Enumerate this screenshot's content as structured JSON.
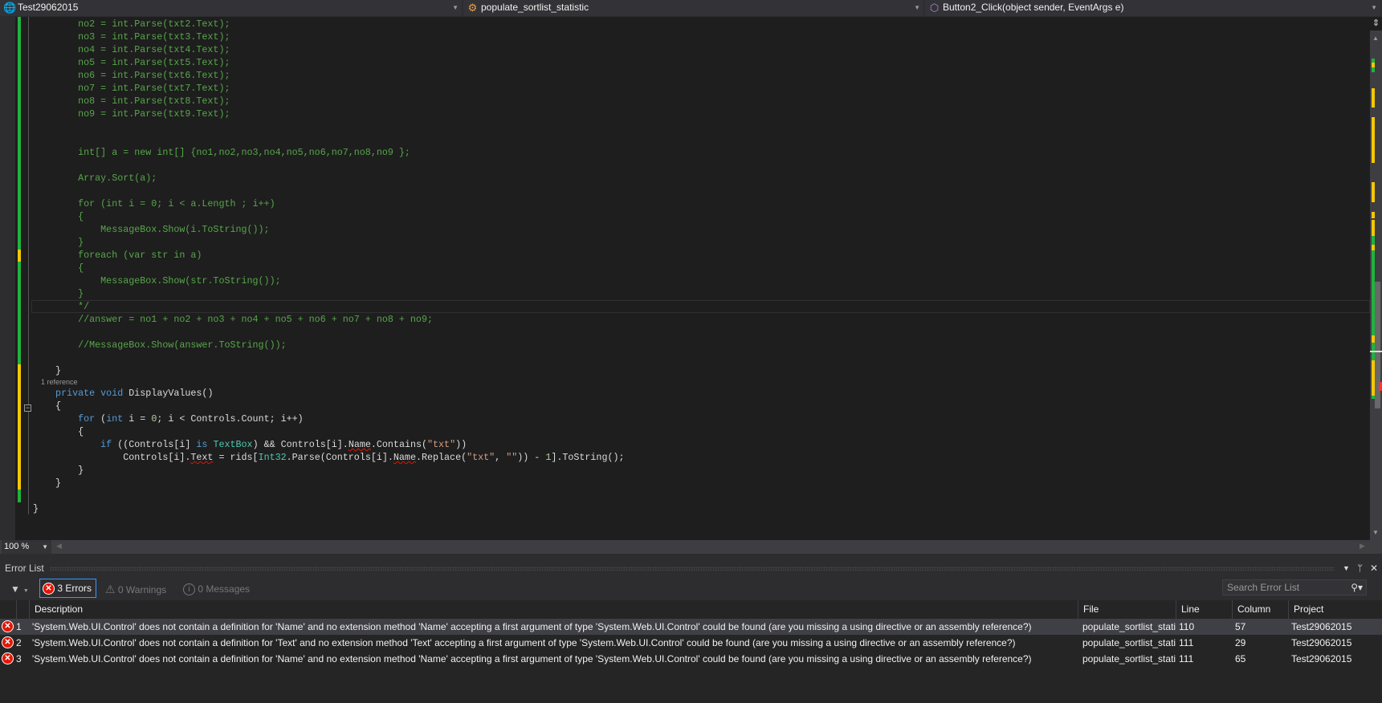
{
  "navbar": {
    "project": "Test29062015",
    "class": "populate_sortlist_statistic",
    "member": "Button2_Click(object sender, EventArgs e)"
  },
  "editor": {
    "lines": [
      [
        [
          "c",
          "        no2 = int.Parse(txt2.Text);"
        ]
      ],
      [
        [
          "c",
          "        no3 = int.Parse(txt3.Text);"
        ]
      ],
      [
        [
          "c",
          "        no4 = int.Parse(txt4.Text);"
        ]
      ],
      [
        [
          "c",
          "        no5 = int.Parse(txt5.Text);"
        ]
      ],
      [
        [
          "c",
          "        no6 = int.Parse(txt6.Text);"
        ]
      ],
      [
        [
          "c",
          "        no7 = int.Parse(txt7.Text);"
        ]
      ],
      [
        [
          "c",
          "        no8 = int.Parse(txt8.Text);"
        ]
      ],
      [
        [
          "c",
          "        no9 = int.Parse(txt9.Text);"
        ]
      ],
      [],
      [],
      [
        [
          "c",
          "        int[] a = new int[] {no1,no2,no3,no4,no5,no6,no7,no8,no9 };"
        ]
      ],
      [],
      [
        [
          "c",
          "        Array.Sort(a);"
        ]
      ],
      [],
      [
        [
          "c",
          "        for (int i = 0; i < a.Length ; i++)"
        ]
      ],
      [
        [
          "c",
          "        {"
        ]
      ],
      [
        [
          "c",
          "            MessageBox.Show(i.ToString());"
        ]
      ],
      [
        [
          "c",
          "        }"
        ]
      ],
      [
        [
          "c",
          "        foreach (var str in a)"
        ]
      ],
      [
        [
          "c",
          "        {"
        ]
      ],
      [
        [
          "c",
          "            MessageBox.Show(str.ToString());"
        ]
      ],
      [
        [
          "c",
          "        }"
        ]
      ],
      [
        [
          "c",
          "        */"
        ]
      ],
      [
        [
          "c",
          "        //answer = no1 + no2 + no3 + no4 + no5 + no6 + no7 + no8 + no9;"
        ]
      ],
      [],
      [
        [
          "c",
          "        //MessageBox.Show(answer.ToString());"
        ]
      ],
      [],
      [
        [
          "p",
          "    }"
        ]
      ],
      [
        [
          "lens",
          "    1 reference"
        ]
      ],
      [
        [
          "k",
          "    private"
        ],
        [
          "p",
          " "
        ],
        [
          "k",
          "void"
        ],
        [
          "p",
          " DisplayValues()"
        ]
      ],
      [
        [
          "p",
          "    {"
        ]
      ],
      [
        [
          "k",
          "        for"
        ],
        [
          "p",
          " ("
        ],
        [
          "k",
          "int"
        ],
        [
          "p",
          " i = "
        ],
        [
          "n",
          "0"
        ],
        [
          "p",
          "; i < Controls.Count; i++)"
        ]
      ],
      [
        [
          "p",
          "        {"
        ]
      ],
      [
        [
          "k",
          "            if"
        ],
        [
          "p",
          " ((Controls[i] "
        ],
        [
          "k",
          "is"
        ],
        [
          "p",
          " "
        ],
        [
          "t",
          "TextBox"
        ],
        [
          "p",
          ") && Controls[i]."
        ],
        [
          "e",
          "Name"
        ],
        [
          "p",
          ".Contains("
        ],
        [
          "s",
          "\"txt\""
        ],
        [
          "p",
          "))"
        ]
      ],
      [
        [
          "p",
          "                Controls[i]."
        ],
        [
          "e",
          "Text"
        ],
        [
          "p",
          " = rids["
        ],
        [
          "t",
          "Int32"
        ],
        [
          "p",
          ".Parse(Controls[i]."
        ],
        [
          "e",
          "Name"
        ],
        [
          "p",
          ".Replace("
        ],
        [
          "s",
          "\"txt\""
        ],
        [
          "p",
          ", "
        ],
        [
          "s",
          "\"\""
        ],
        [
          "p",
          ")) - "
        ],
        [
          "n",
          "1"
        ],
        [
          "p",
          "].ToString();"
        ]
      ],
      [
        [
          "p",
          "        }"
        ]
      ],
      [
        [
          "p",
          "    }"
        ]
      ],
      [],
      [
        [
          "p",
          "}"
        ]
      ]
    ]
  },
  "zoom": "100 %",
  "error_list": {
    "title": "Error List",
    "errors_label": "3 Errors",
    "warnings_label": "0 Warnings",
    "messages_label": "0 Messages",
    "search_placeholder": "Search Error List",
    "columns": [
      "Description",
      "File",
      "Line",
      "Column",
      "Project"
    ],
    "rows": [
      {
        "num": "1",
        "description": "'System.Web.UI.Control' does not contain a definition for 'Name' and no extension method 'Name' accepting a first argument of type 'System.Web.UI.Control' could be found (are you missing a using directive or an assembly reference?)",
        "file": "populate_sortlist_stati:",
        "line": "110",
        "column": "57",
        "project": "Test29062015"
      },
      {
        "num": "2",
        "description": "'System.Web.UI.Control' does not contain a definition for 'Text' and no extension method 'Text' accepting a first argument of type 'System.Web.UI.Control' could be found (are you missing a using directive or an assembly reference?)",
        "file": "populate_sortlist_stati:",
        "line": "111",
        "column": "29",
        "project": "Test29062015"
      },
      {
        "num": "3",
        "description": "'System.Web.UI.Control' does not contain a definition for 'Name' and no extension method 'Name' accepting a first argument of type 'System.Web.UI.Control' could be found (are you missing a using directive or an assembly reference?)",
        "file": "populate_sortlist_stati:",
        "line": "111",
        "column": "65",
        "project": "Test29062015"
      }
    ]
  }
}
